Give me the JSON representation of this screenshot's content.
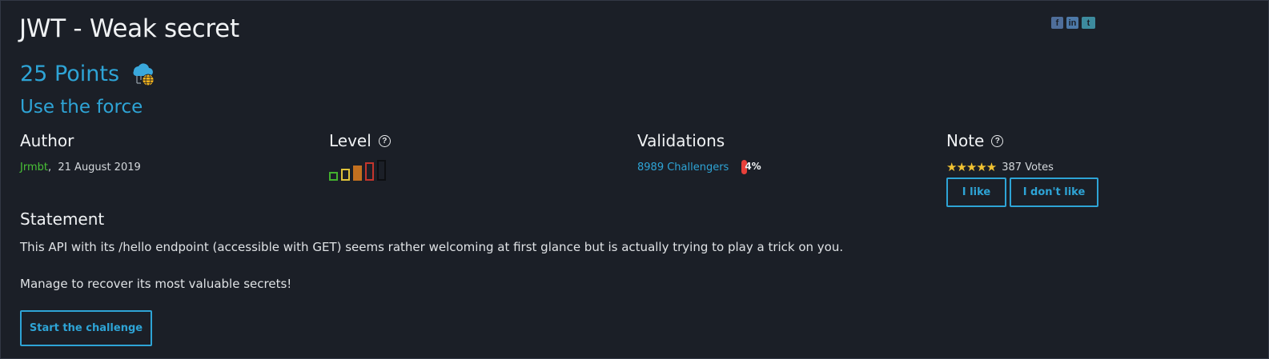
{
  "challenge": {
    "title": "JWT - Weak secret",
    "points": "25 Points",
    "category_icon": "cloud-web-icon",
    "subtitle": "Use the force"
  },
  "share": [
    {
      "name": "facebook-icon",
      "glyph": "f"
    },
    {
      "name": "linkedin-icon",
      "glyph": "in"
    },
    {
      "name": "twitter-icon",
      "glyph": "t"
    }
  ],
  "author": {
    "heading": "Author",
    "name": "Jrmbt",
    "separator": ",",
    "date": "21 August 2019"
  },
  "level": {
    "heading": "Level",
    "help_icon": "?",
    "value": 3,
    "max": 5,
    "colors": [
      "#43b12e",
      "#e0c33a",
      "#c3701f",
      "#c4352c",
      "#0d0f12"
    ]
  },
  "validations": {
    "heading": "Validations",
    "challengers": "8989 Challengers",
    "percent": "4%",
    "accent": "#e8403a"
  },
  "note": {
    "heading": "Note",
    "help_icon": "?",
    "stars": "★★★★★",
    "rating": 5,
    "votes": "387 Votes",
    "like_label": "I like",
    "dislike_label": "I don't like"
  },
  "statement": {
    "heading": "Statement",
    "paragraphs": [
      "This API with its /hello endpoint (accessible with GET) seems rather welcoming at first glance but is actually trying to play a trick on you.",
      "Manage to recover its most valuable secrets!"
    ],
    "start_label": "Start the challenge"
  },
  "colors": {
    "background": "#1b1f27",
    "accent": "#2ea4d6",
    "author_link": "#49c236",
    "star": "#f1c232"
  }
}
